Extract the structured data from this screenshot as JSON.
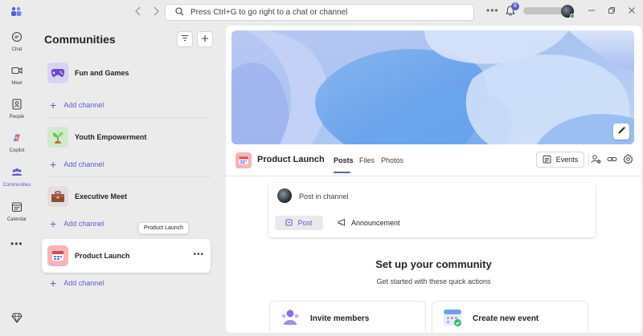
{
  "titlebar": {
    "search_placeholder": "Press Ctrl+G to go right to a chat or channel",
    "notification_count": "8",
    "back_icon": "chevron-left-icon",
    "forward_icon": "chevron-right-icon",
    "more_icon": "more-horizontal-icon"
  },
  "rail": {
    "items": [
      {
        "label": "Chat",
        "icon": "chat-icon"
      },
      {
        "label": "Meet",
        "icon": "video-icon"
      },
      {
        "label": "People",
        "icon": "people-icon"
      },
      {
        "label": "Copilot",
        "icon": "copilot-icon"
      },
      {
        "label": "Communities",
        "icon": "communities-icon"
      },
      {
        "label": "Calendar",
        "icon": "calendar-icon"
      }
    ],
    "more_label": "•••"
  },
  "communities": {
    "title": "Communities",
    "list": [
      {
        "name": "Fun and Games",
        "add_channel": "Add channel"
      },
      {
        "name": "Youth Empowerment",
        "add_channel": "Add channel"
      },
      {
        "name": "Executive Meet",
        "add_channel": "Add channel"
      },
      {
        "name": "Product Launch",
        "add_channel": "Add channel"
      }
    ],
    "tooltip": "Product Launch",
    "more_label": "•••"
  },
  "channel": {
    "title": "Product Launch",
    "tabs": [
      {
        "label": "Posts"
      },
      {
        "label": "Files"
      },
      {
        "label": "Photos"
      }
    ],
    "events_label": "Events"
  },
  "composer": {
    "prompt": "Post in channel",
    "post_label": "Post",
    "announcement_label": "Announcement"
  },
  "setup": {
    "title": "Set up your community",
    "subtitle": "Get started with these quick actions",
    "actions": [
      {
        "label": "Invite members"
      },
      {
        "label": "Create new event"
      }
    ]
  },
  "colors": {
    "accent": "#5b5fc7",
    "background": "#ebebeb",
    "surface": "#ffffff"
  }
}
